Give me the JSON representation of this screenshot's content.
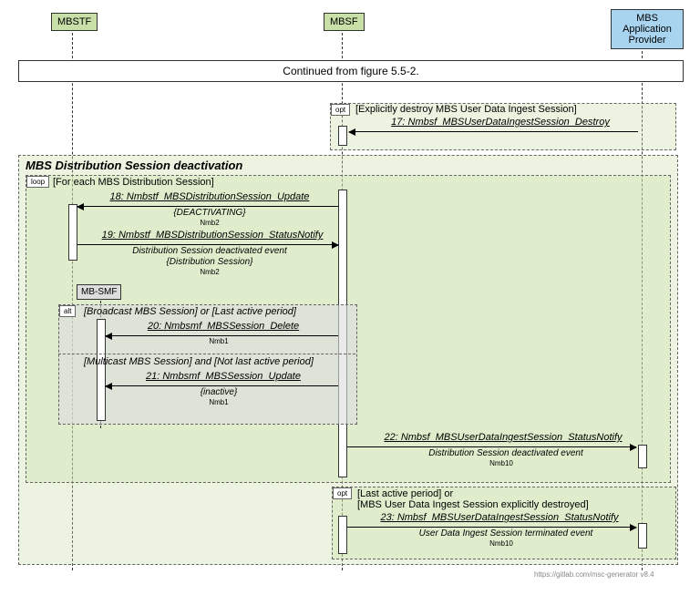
{
  "actors": {
    "mbstf": "MBSTF",
    "mbsf": "MBSF",
    "app_provider": "MBS\nApplication\nProvider",
    "mbsmf": "MB-SMF"
  },
  "continued": "Continued from figure 5.5-2.",
  "frag_opt1": {
    "tag": "opt",
    "guard": "[Explicitly destroy MBS User Data Ingest Session]",
    "msg17": "17: Nmbsf_MBSUserDataIngestSession_Destroy"
  },
  "section_title": "MBS Distribution Session deactivation",
  "frag_loop": {
    "tag": "loop",
    "guard": "[For each MBS Distribution Session]",
    "msg18": "18: Nmbstf_MBSDistributionSession_Update",
    "sub18a": "{DEACTIVATING}",
    "sub18b": "Nmb2",
    "msg19": "19: Nmbstf_MBSDistributionSession_StatusNotify",
    "sub19a": "Distribution Session deactivated event",
    "sub19b": "{Distribution Session}",
    "sub19c": "Nmb2"
  },
  "frag_alt": {
    "tag": "alt",
    "guard1": "[Broadcast MBS Session] or [Last active period]",
    "msg20": "20: Nmbsmf_MBSSession_Delete",
    "sub20": "Nmb1",
    "guard2": "[Multicast MBS Session] and [Not last active period]",
    "msg21": "21: Nmbsmf_MBSSession_Update",
    "sub21a": "{inactive}",
    "sub21b": "Nmb1"
  },
  "msg22": "22: Nmbsf_MBSUserDataIngestSession_StatusNotify",
  "sub22a": "Distribution Session deactivated event",
  "sub22b": "Nmb10",
  "frag_opt2": {
    "tag": "opt",
    "guard": "[Last active period] or\n[MBS User Data Ingest Session explicitly destroyed]",
    "msg23": "23: Nmbsf_MBSUserDataIngestSession_StatusNotify",
    "sub23a": "User Data Ingest Session terminated event",
    "sub23b": "Nmb10"
  },
  "credit": "https://gitlab.com/msc-generator v8.4"
}
